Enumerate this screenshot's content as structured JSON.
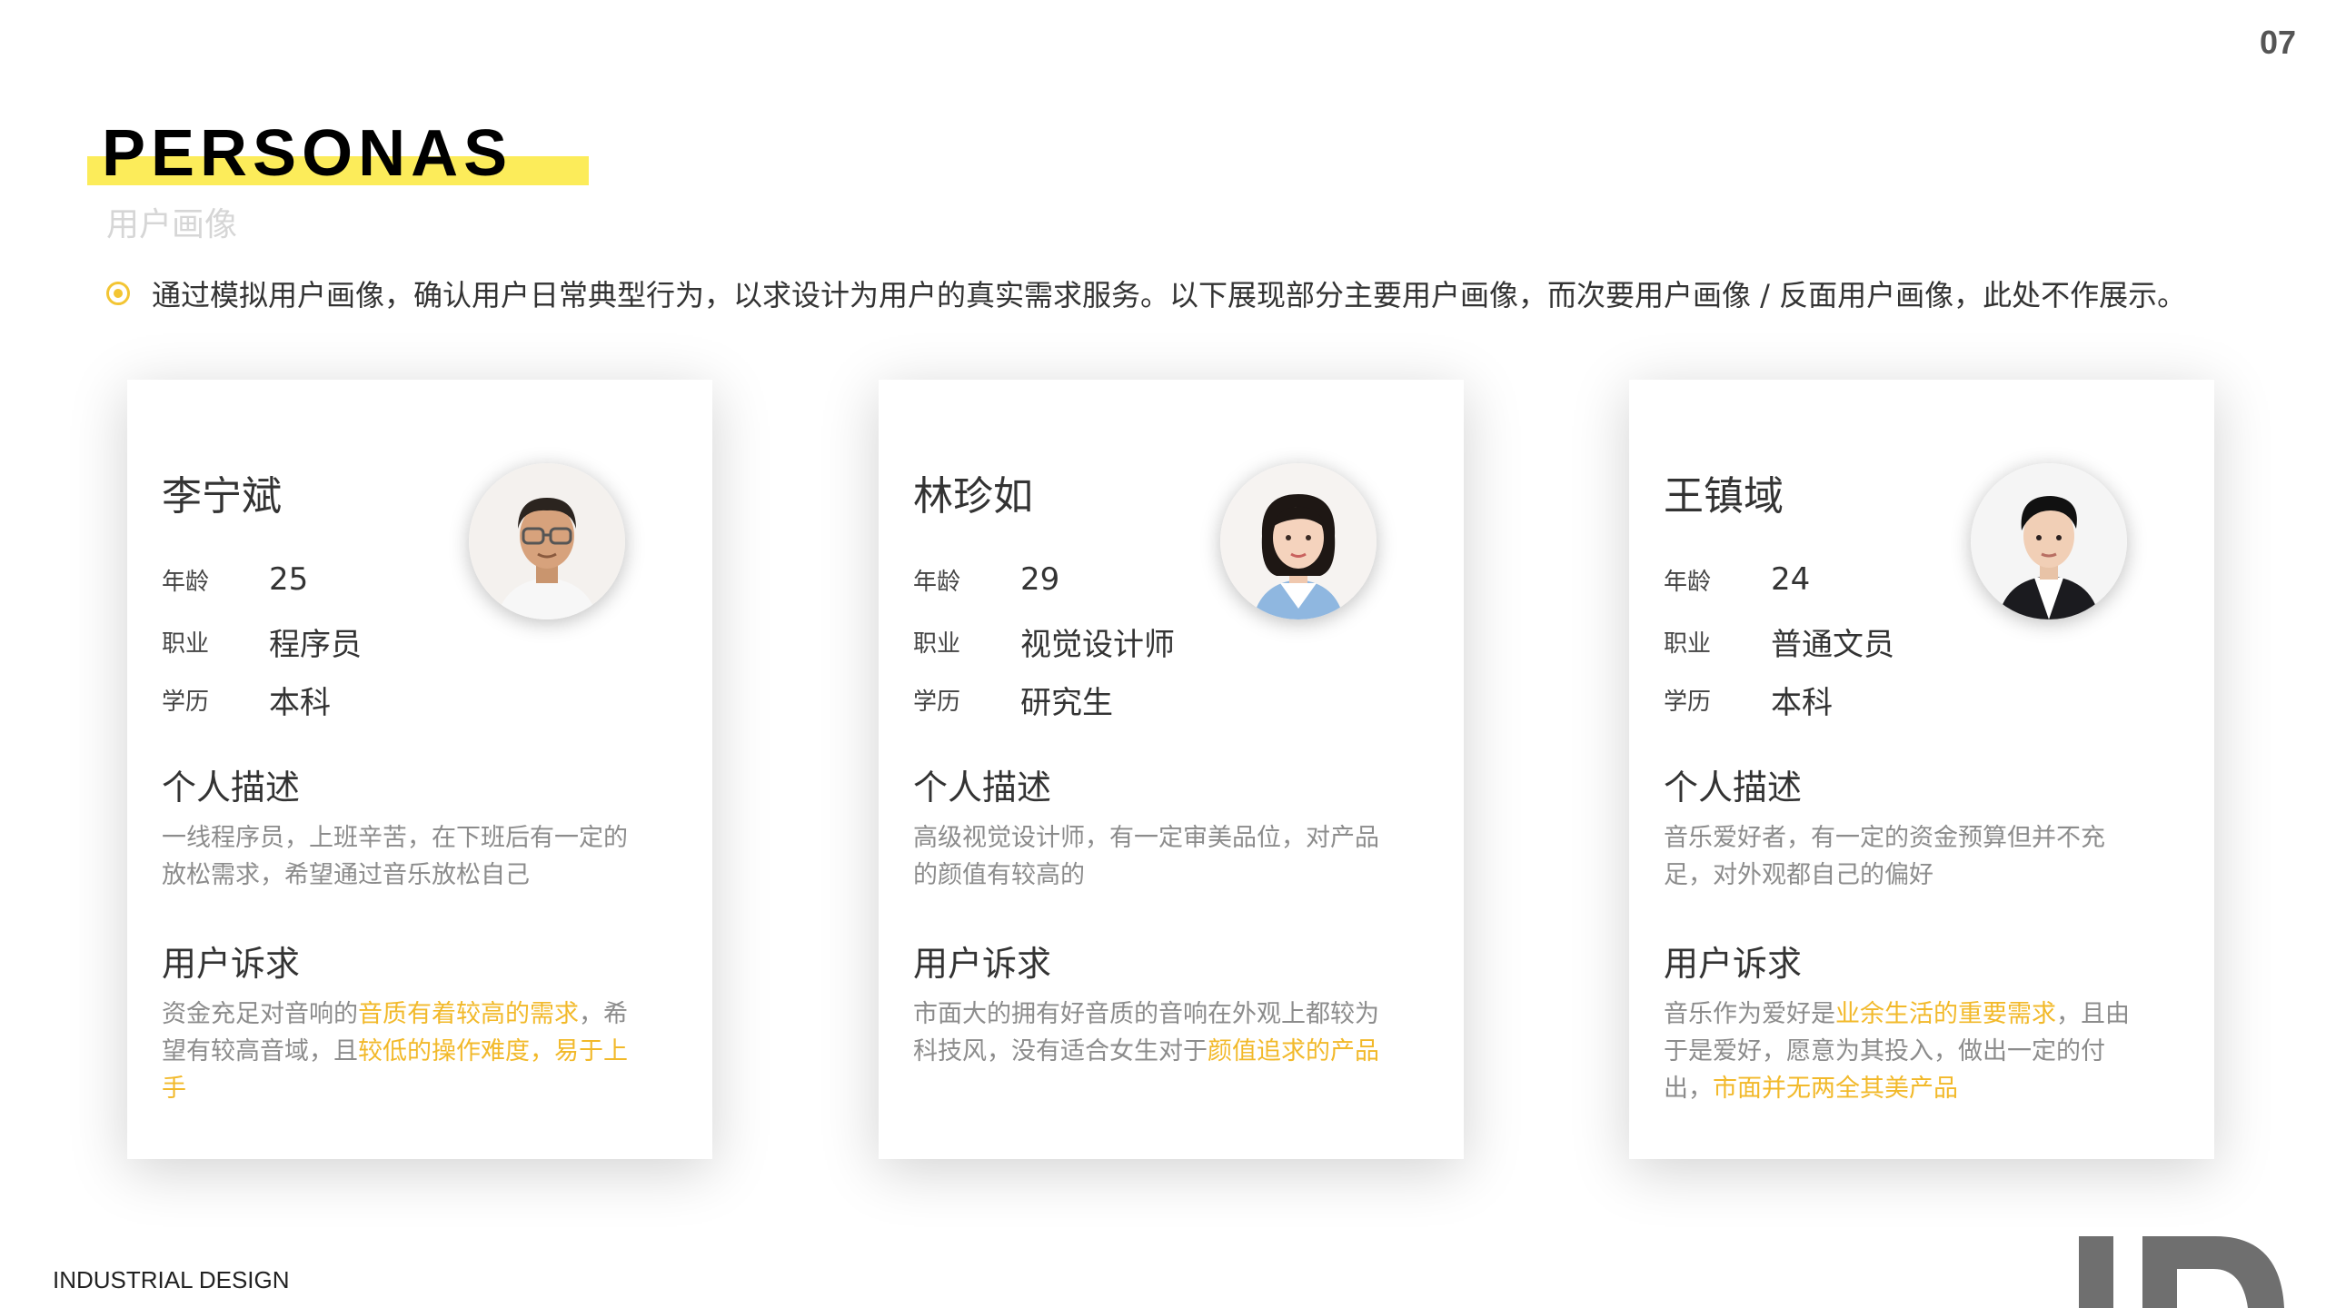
{
  "page": {
    "number": "07",
    "title": "PERSONAS",
    "subtitle": "用户画像",
    "intro": "通过模拟用户画像，确认用户日常典型行为，以求设计为用户的真实需求服务。以下展现部分主要用户画像，而次要用户画像 / 反面用户画像，此处不作展示。",
    "footer": "INDUSTRIAL DESIGN"
  },
  "labels": {
    "age": "年龄",
    "job": "职业",
    "edu": "学历",
    "desc_title": "个人描述",
    "need_title": "用户诉求"
  },
  "colors": {
    "accent_yellow": "#fcec5a",
    "highlight": "#f2b92a",
    "bullet": "#f3c533"
  },
  "personas": [
    {
      "name": "李宁斌",
      "avatar_icon": "man-glasses-avatar-icon",
      "age": "25",
      "job": "程序员",
      "edu": "本科",
      "desc": "一线程序员，上班辛苦，在下班后有一定的放松需求，希望通过音乐放松自己",
      "need_parts": [
        {
          "text": "资金充足对音响的",
          "hl": false
        },
        {
          "text": "音质有着较高的需求",
          "hl": true
        },
        {
          "text": "，希望有较高音域，且",
          "hl": false
        },
        {
          "text": "较低的操作难度，易于上手",
          "hl": true
        }
      ]
    },
    {
      "name": "林珍如",
      "avatar_icon": "woman-avatar-icon",
      "age": "29",
      "job": "视觉设计师",
      "edu": "研究生",
      "desc": "高级视觉设计师，有一定审美品位，对产品的颜值有较高的",
      "need_parts": [
        {
          "text": "市面大的拥有好音质的音响在外观上都较为科技风，没有适合女生对于",
          "hl": false
        },
        {
          "text": "颜值追求的产品",
          "hl": true
        }
      ]
    },
    {
      "name": "王镇域",
      "avatar_icon": "man-suit-avatar-icon",
      "age": "24",
      "job": "普通文员",
      "edu": "本科",
      "desc": "音乐爱好者，有一定的资金预算但并不充足，对外观都自己的偏好",
      "need_parts": [
        {
          "text": "音乐作为爱好是",
          "hl": false
        },
        {
          "text": "业余生活的重要需求",
          "hl": true
        },
        {
          "text": "，且由于是爱好，愿意为其投入，做出一定的付出，",
          "hl": false
        },
        {
          "text": "市面并无两全其美产品",
          "hl": true
        }
      ]
    }
  ]
}
